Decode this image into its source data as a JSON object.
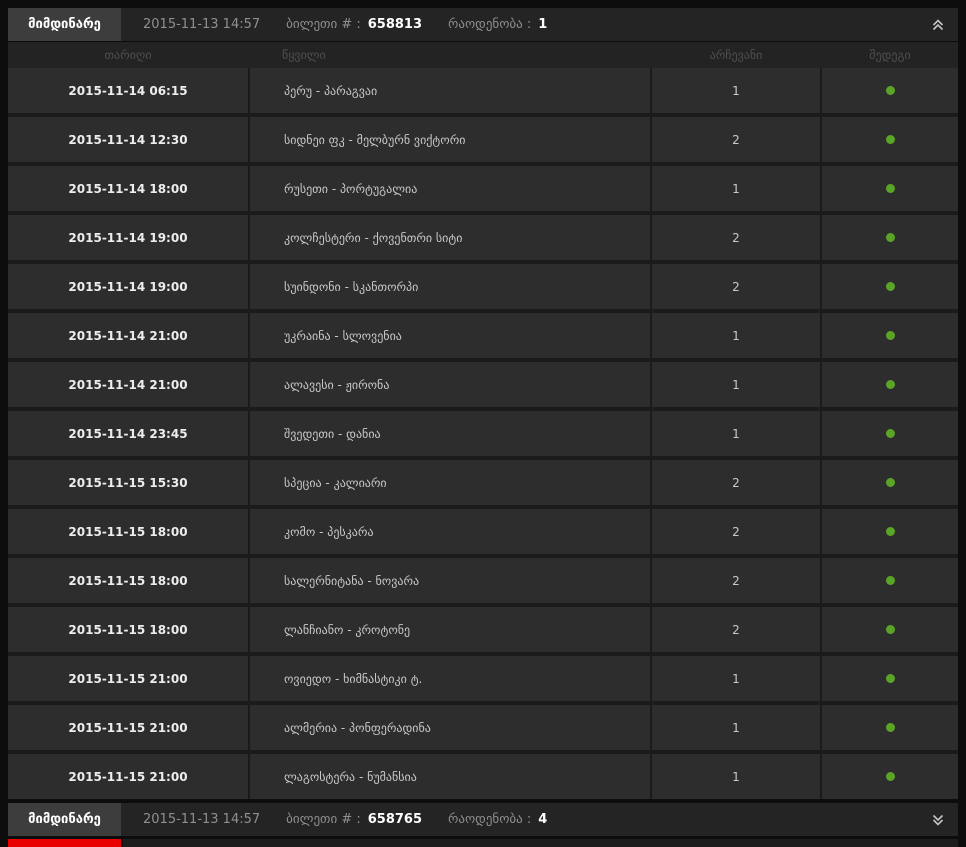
{
  "colors": {
    "result_green": "#5ba427",
    "lost_red": "#e80000",
    "bar_background": "#242424",
    "tab_background": "#3d3d3d",
    "row_background": "#2d2d2d"
  },
  "top_ticket": {
    "tab_label": "მიმდინარე",
    "datetime": "2015-11-13 14:57",
    "ticket_label": "ბილეთი # :",
    "ticket_number": "658813",
    "count_label": "რაოდენობა :",
    "count_value": "1",
    "toggle_icon": "chevron-double-up"
  },
  "table": {
    "headers": {
      "date": "თარიღი",
      "pair": "წყვილი",
      "choice": "არჩევანი",
      "result": "შედეგი"
    },
    "rows": [
      {
        "date": "2015-11-14 06:15",
        "pair": "პერუ - პარაგვაი",
        "choice": "1",
        "result": "won"
      },
      {
        "date": "2015-11-14 12:30",
        "pair": "სიდნეი ფკ - მელბურნ ვიქტორი",
        "choice": "2",
        "result": "won"
      },
      {
        "date": "2015-11-14 18:00",
        "pair": "რუსეთი - პორტუგალია",
        "choice": "1",
        "result": "won"
      },
      {
        "date": "2015-11-14 19:00",
        "pair": "კოლჩესტერი - ქოვენთრი სიტი",
        "choice": "2",
        "result": "won"
      },
      {
        "date": "2015-11-14 19:00",
        "pair": "სუინდონი - სკანთორპი",
        "choice": "2",
        "result": "won"
      },
      {
        "date": "2015-11-14 21:00",
        "pair": "უკრაინა - სლოვენია",
        "choice": "1",
        "result": "won"
      },
      {
        "date": "2015-11-14 21:00",
        "pair": "ალავესი - ჟირონა",
        "choice": "1",
        "result": "won"
      },
      {
        "date": "2015-11-14 23:45",
        "pair": "შვედეთი - დანია",
        "choice": "1",
        "result": "won"
      },
      {
        "date": "2015-11-15 15:30",
        "pair": "სპეცია - კალიარი",
        "choice": "2",
        "result": "won"
      },
      {
        "date": "2015-11-15 18:00",
        "pair": "კომო - პესკარა",
        "choice": "2",
        "result": "won"
      },
      {
        "date": "2015-11-15 18:00",
        "pair": "სალერნიტანა - ნოვარა",
        "choice": "2",
        "result": "won"
      },
      {
        "date": "2015-11-15 18:00",
        "pair": "ლანჩიანო - კროტონე",
        "choice": "2",
        "result": "won"
      },
      {
        "date": "2015-11-15 21:00",
        "pair": "ოვიედო - ხიმნასტიკი ტ.",
        "choice": "1",
        "result": "won"
      },
      {
        "date": "2015-11-15 21:00",
        "pair": "ალმერია - პონფერადინა",
        "choice": "1",
        "result": "won"
      },
      {
        "date": "2015-11-15 21:00",
        "pair": "ლაგოსტერა - ნუმანსია",
        "choice": "1",
        "result": "won"
      }
    ]
  },
  "bottom_ticket": {
    "tab_label": "მიმდინარე",
    "datetime": "2015-11-13 14:57",
    "ticket_label": "ბილეთი # :",
    "ticket_number": "658765",
    "count_label": "რაოდენობა :",
    "count_value": "4",
    "toggle_icon": "chevron-double-down"
  }
}
